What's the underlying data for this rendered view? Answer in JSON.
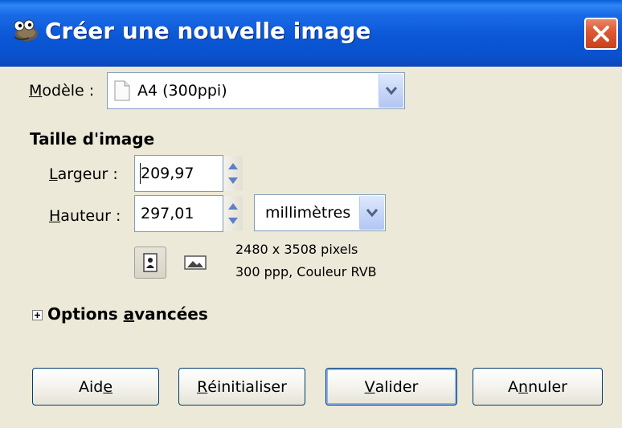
{
  "window": {
    "title": "Créer une nouvelle image",
    "app_icon": "gimp-wilber-icon",
    "close_icon": "close-icon"
  },
  "template": {
    "label_underlined": "M",
    "label_rest": "odèle :",
    "value": "A4 (300ppi)"
  },
  "image_size": {
    "heading": "Taille d'image",
    "width_label_underlined": "L",
    "width_label_rest": "argeur :",
    "width_value": "209,97",
    "height_label_underlined": "H",
    "height_label_rest": "auteur :",
    "height_value": "297,01",
    "unit": "millimètres",
    "info_pixels": "2480 x 3508 pixels",
    "info_resolution": "300 ppp, Couleur RVB"
  },
  "advanced": {
    "label_before": "Options ",
    "label_underlined": "a",
    "label_after": "vancées"
  },
  "buttons": {
    "help_before": "Aid",
    "help_underlined": "e",
    "reset_underlined": "R",
    "reset_rest": "éinitialiser",
    "ok_underlined": "V",
    "ok_rest": "alider",
    "cancel_before": "A",
    "cancel_underlined": "n",
    "cancel_after": "nuler"
  },
  "colors": {
    "titlebar": "#0a57d6",
    "dialog_bg": "#ece9d8",
    "close_button": "#d85a33",
    "field_border": "#7f9db9"
  }
}
